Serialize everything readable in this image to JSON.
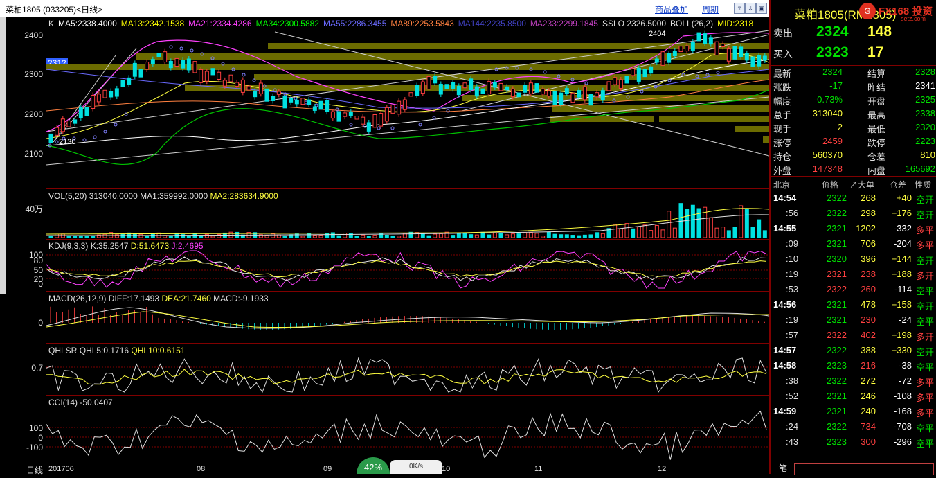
{
  "header": {
    "title": "菜粕1805 (033205)<日线>",
    "overlay_link": "商品叠加",
    "period_link": "周期",
    "buttons": [
      "⇧",
      "⇩",
      "▣"
    ]
  },
  "main_chart": {
    "indicators": [
      {
        "label": "K",
        "color": "#e0e0e0"
      },
      {
        "label": "MA5:2338.4000",
        "color": "#ffffff"
      },
      {
        "label": "MA13:2342.1538",
        "color": "#ffff00"
      },
      {
        "label": "MA21:2334.4286",
        "color": "#ff40ff"
      },
      {
        "label": "MA34:2300.5882",
        "color": "#00ff00"
      },
      {
        "label": "MA55:2286.3455",
        "color": "#6a6aff"
      },
      {
        "label": "MA89:2253.5843",
        "color": "#ff8040"
      },
      {
        "label": "MA144:2235.8500",
        "color": "#4040c0"
      },
      {
        "label": "MA233:2299.1845",
        "color": "#c040c0"
      },
      {
        "label": "SSLO 2326.5000",
        "color": "#e0e0e0"
      },
      {
        "label": "BOLL(26,2)",
        "color": "#e0e0e0"
      },
      {
        "label": "MID:2318",
        "color": "#ffff00"
      }
    ],
    "y_ticks": [
      "2400",
      "2300",
      "2200",
      "2100"
    ],
    "current_price_tag": "2312",
    "high_label": "2404",
    "low_label": "2130"
  },
  "volume": {
    "label_vol": "VOL(5,20) 313040.0000",
    "label_ma1": "MA1:359992.0000",
    "label_ma2": "MA2:283634.9000",
    "y_tick": "40万"
  },
  "kdj": {
    "label_main": "KDJ(9,3,3)",
    "label_k": "K:35.2547",
    "label_d": "D:51.6473",
    "label_j": "J:2.4695",
    "y_ticks": [
      "100",
      "80",
      "50",
      "20",
      "0"
    ]
  },
  "macd": {
    "label_main": "MACD(26,12,9)",
    "label_diff": "DIFF:17.1493",
    "label_dea": "DEA:21.7460",
    "label_macd": "MACD:-9.1933",
    "y_tick": "0"
  },
  "qhlsr": {
    "label_main": "QHLSR",
    "label_q5": "QHL5:0.1716",
    "label_q10": "QHL10:0.6151",
    "y_tick": "0.7"
  },
  "cci": {
    "label_main": "CCI(14) -50.0407",
    "y_ticks": [
      "100",
      "0",
      "-100"
    ]
  },
  "x_axis": {
    "period_label": "日线",
    "labels": [
      "201706",
      "08",
      "09",
      "10",
      "11",
      "12"
    ]
  },
  "status_overlay": {
    "percent": "42%",
    "speed": "0K/s"
  },
  "quote": {
    "symbol": "菜粕1805(RM1805)",
    "brand": "FX168 投资",
    "brand_sub": "setz.com",
    "ask_label": "卖出",
    "ask_price": "2324",
    "ask_vol": "148",
    "bid_label": "买入",
    "bid_price": "2323",
    "bid_vol": "17",
    "stats": [
      {
        "l1": "最新",
        "v1": "2324",
        "c1": "green",
        "l2": "结算",
        "v2": "2328",
        "c2": "green"
      },
      {
        "l1": "涨跌",
        "v1": "-17",
        "c1": "green",
        "l2": "昨结",
        "v2": "2341",
        "c2": "white"
      },
      {
        "l1": "幅度",
        "v1": "-0.73%",
        "c1": "green",
        "l2": "开盘",
        "v2": "2325",
        "c2": "green"
      },
      {
        "l1": "总手",
        "v1": "313040",
        "c1": "yellow",
        "l2": "最高",
        "v2": "2338",
        "c2": "green"
      },
      {
        "l1": "现手",
        "v1": "2",
        "c1": "yellow",
        "l2": "最低",
        "v2": "2320",
        "c2": "green"
      },
      {
        "l1": "涨停",
        "v1": "2459",
        "c1": "red",
        "l2": "跌停",
        "v2": "2223",
        "c2": "green"
      },
      {
        "l1": "持仓",
        "v1": "560370",
        "c1": "yellow",
        "l2": "仓差",
        "v2": "810",
        "c2": "yellow"
      },
      {
        "l1": "外盘",
        "v1": "147348",
        "c1": "red",
        "l2": "内盘",
        "v2": "165692",
        "c2": "green"
      }
    ],
    "tick_headers": [
      "北京",
      "价格",
      "↗大单",
      "仓差",
      "性质"
    ],
    "ticks": [
      {
        "time": "14:54",
        "price": "2322",
        "pc": "green",
        "vol": "268",
        "vc": "yellow",
        "diff": "+40",
        "nature": "空开"
      },
      {
        "time": ":56",
        "price": "2322",
        "pc": "green",
        "vol": "298",
        "vc": "yellow",
        "diff": "+176",
        "nature": "空开"
      },
      {
        "time": "14:55",
        "price": "2321",
        "pc": "green",
        "vol": "1202",
        "vc": "yellow",
        "diff": "-332",
        "nature": "多平"
      },
      {
        "time": ":09",
        "price": "2321",
        "pc": "green",
        "vol": "706",
        "vc": "yellow",
        "diff": "-204",
        "nature": "多平"
      },
      {
        "time": ":10",
        "price": "2320",
        "pc": "green",
        "vol": "396",
        "vc": "yellow",
        "diff": "+144",
        "nature": "空开"
      },
      {
        "time": ":19",
        "price": "2321",
        "pc": "red",
        "vol": "238",
        "vc": "red",
        "diff": "+188",
        "nature": "多开"
      },
      {
        "time": ":53",
        "price": "2322",
        "pc": "red",
        "vol": "260",
        "vc": "red",
        "diff": "-114",
        "nature": "空平"
      },
      {
        "time": "14:56",
        "price": "2321",
        "pc": "green",
        "vol": "478",
        "vc": "yellow",
        "diff": "+158",
        "nature": "空开"
      },
      {
        "time": ":19",
        "price": "2321",
        "pc": "green",
        "vol": "230",
        "vc": "red",
        "diff": "-24",
        "nature": "空平"
      },
      {
        "time": ":57",
        "price": "2322",
        "pc": "red",
        "vol": "402",
        "vc": "red",
        "diff": "+198",
        "nature": "多开"
      },
      {
        "time": "14:57",
        "price": "2322",
        "pc": "green",
        "vol": "388",
        "vc": "yellow",
        "diff": "+330",
        "nature": "空开"
      },
      {
        "time": "14:58",
        "price": "2323",
        "pc": "green",
        "vol": "216",
        "vc": "red",
        "diff": "-38",
        "nature": "空平"
      },
      {
        "time": ":38",
        "price": "2322",
        "pc": "green",
        "vol": "272",
        "vc": "yellow",
        "diff": "-72",
        "nature": "多平"
      },
      {
        "time": ":52",
        "price": "2321",
        "pc": "green",
        "vol": "246",
        "vc": "yellow",
        "diff": "-108",
        "nature": "多平"
      },
      {
        "time": "14:59",
        "price": "2321",
        "pc": "green",
        "vol": "240",
        "vc": "yellow",
        "diff": "-168",
        "nature": "多平"
      },
      {
        "time": ":24",
        "price": "2322",
        "pc": "green",
        "vol": "734",
        "vc": "red",
        "diff": "-708",
        "nature": "空平"
      },
      {
        "time": ":43",
        "price": "2323",
        "pc": "green",
        "vol": "300",
        "vc": "red",
        "diff": "-296",
        "nature": "空平"
      }
    ],
    "footer_label": "笔"
  }
}
